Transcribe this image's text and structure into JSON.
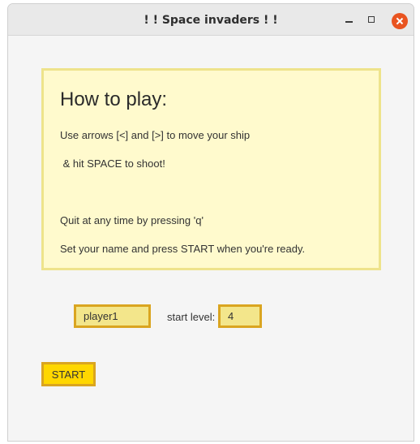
{
  "window": {
    "title": "! ! Space invaders ! !"
  },
  "instructions": {
    "heading": "How to play:",
    "lines": [
      "Use arrows [<] and [>] to move your ship",
      " & hit SPACE to shoot!",
      "Quit at any time by pressing 'q'",
      "Set your name and press START when you're ready."
    ]
  },
  "form": {
    "name_value": "player1",
    "level_label": "start level:",
    "level_value": "4",
    "start_label": "START"
  },
  "colors": {
    "accent_close": "#e95420",
    "panel_background": "#fffacd",
    "panel_border": "#eee38b",
    "field_background": "#f3e68b",
    "field_border": "#daa520",
    "start_button": "#ffd700"
  },
  "icons": {
    "minimize": "minimize-icon",
    "maximize": "maximize-icon",
    "close": "close-icon"
  }
}
